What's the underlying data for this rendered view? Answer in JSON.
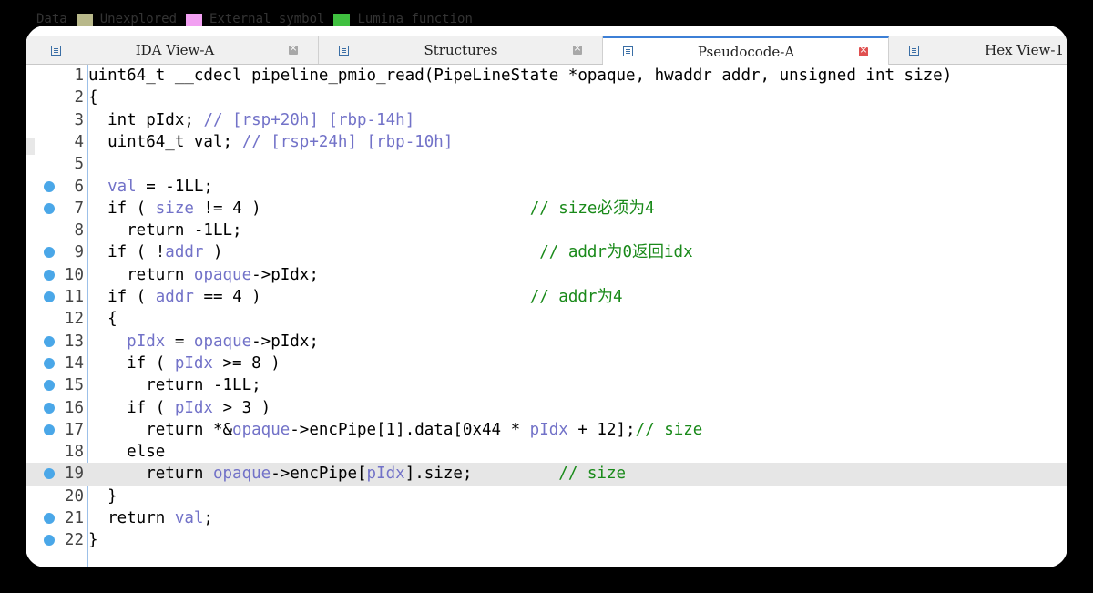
{
  "legend": [
    {
      "label": "Data",
      "color": ""
    },
    {
      "label": "Unexplored",
      "color": "#b8b88a"
    },
    {
      "label": "External symbol",
      "color": "#f2a0f2"
    },
    {
      "label": "Lumina function",
      "color": "#40c040"
    }
  ],
  "tabs": [
    {
      "label": "IDA View-A",
      "active": false
    },
    {
      "label": "Structures",
      "active": false
    },
    {
      "label": "Pseudocode-A",
      "active": true
    },
    {
      "label": "Hex View-1",
      "active": false
    }
  ],
  "colors": {
    "variable": "#7272c8",
    "comment": "#1a8a1a",
    "breakpoint": "#4aa7e8",
    "highlight": "#e6e6e6",
    "active_tab_accent": "#3c7fd6"
  },
  "code": [
    {
      "n": "1",
      "bp": false,
      "hl": false,
      "segs": [
        {
          "t": "uint64_t __cdecl pipeline_pmio_read(PipeLineState *opaque, hwaddr addr, unsigned int size)"
        }
      ]
    },
    {
      "n": "2",
      "bp": false,
      "hl": false,
      "segs": [
        {
          "t": "{"
        }
      ]
    },
    {
      "n": "3",
      "bp": false,
      "hl": false,
      "segs": [
        {
          "t": "  int pIdx; "
        },
        {
          "t": "// [rsp+20h] [rbp-14h]",
          "c": "var"
        }
      ]
    },
    {
      "n": "4",
      "bp": false,
      "hl": false,
      "segs": [
        {
          "t": "  uint64_t val; "
        },
        {
          "t": "// [rsp+24h] [rbp-10h]",
          "c": "var"
        }
      ]
    },
    {
      "n": "5",
      "bp": false,
      "hl": false,
      "segs": [
        {
          "t": ""
        }
      ]
    },
    {
      "n": "6",
      "bp": true,
      "hl": false,
      "segs": [
        {
          "t": "  "
        },
        {
          "t": "val",
          "c": "var"
        },
        {
          "t": " = -1LL;"
        }
      ]
    },
    {
      "n": "7",
      "bp": true,
      "hl": false,
      "segs": [
        {
          "t": "  if ( "
        },
        {
          "t": "size",
          "c": "var"
        },
        {
          "t": " != 4 )                            "
        },
        {
          "t": "// size必须为4",
          "c": "cmt"
        }
      ]
    },
    {
      "n": "8",
      "bp": false,
      "hl": false,
      "segs": [
        {
          "t": "    return -1LL;"
        }
      ]
    },
    {
      "n": "9",
      "bp": true,
      "hl": false,
      "segs": [
        {
          "t": "  if ( !"
        },
        {
          "t": "addr",
          "c": "var"
        },
        {
          "t": " )                                 "
        },
        {
          "t": "// addr为0返回idx",
          "c": "cmt"
        }
      ]
    },
    {
      "n": "10",
      "bp": true,
      "hl": false,
      "segs": [
        {
          "t": "    return "
        },
        {
          "t": "opaque",
          "c": "var"
        },
        {
          "t": "->pIdx;"
        }
      ]
    },
    {
      "n": "11",
      "bp": true,
      "hl": false,
      "segs": [
        {
          "t": "  if ( "
        },
        {
          "t": "addr",
          "c": "var"
        },
        {
          "t": " == 4 )                            "
        },
        {
          "t": "// addr为4",
          "c": "cmt"
        }
      ]
    },
    {
      "n": "12",
      "bp": false,
      "hl": false,
      "segs": [
        {
          "t": "  {"
        }
      ]
    },
    {
      "n": "13",
      "bp": true,
      "hl": false,
      "segs": [
        {
          "t": "    "
        },
        {
          "t": "pIdx",
          "c": "var"
        },
        {
          "t": " = "
        },
        {
          "t": "opaque",
          "c": "var"
        },
        {
          "t": "->pIdx;"
        }
      ]
    },
    {
      "n": "14",
      "bp": true,
      "hl": false,
      "segs": [
        {
          "t": "    if ( "
        },
        {
          "t": "pIdx",
          "c": "var"
        },
        {
          "t": " >= 8 )"
        }
      ]
    },
    {
      "n": "15",
      "bp": true,
      "hl": false,
      "segs": [
        {
          "t": "      return -1LL;"
        }
      ]
    },
    {
      "n": "16",
      "bp": true,
      "hl": false,
      "segs": [
        {
          "t": "    if ( "
        },
        {
          "t": "pIdx",
          "c": "var"
        },
        {
          "t": " > 3 )"
        }
      ]
    },
    {
      "n": "17",
      "bp": true,
      "hl": false,
      "segs": [
        {
          "t": "      return *&"
        },
        {
          "t": "opaque",
          "c": "var"
        },
        {
          "t": "->encPipe[1].data[0x44 * "
        },
        {
          "t": "pIdx",
          "c": "var"
        },
        {
          "t": " + 12];"
        },
        {
          "t": "// size",
          "c": "cmt"
        }
      ]
    },
    {
      "n": "18",
      "bp": false,
      "hl": false,
      "segs": [
        {
          "t": "    else"
        }
      ]
    },
    {
      "n": "19",
      "bp": true,
      "hl": true,
      "segs": [
        {
          "t": "      return "
        },
        {
          "t": "opaque",
          "c": "var"
        },
        {
          "t": "->encPipe["
        },
        {
          "t": "pIdx",
          "c": "var"
        },
        {
          "t": "].size;         "
        },
        {
          "t": "// size",
          "c": "cmt"
        }
      ]
    },
    {
      "n": "20",
      "bp": false,
      "hl": false,
      "segs": [
        {
          "t": "  }"
        }
      ]
    },
    {
      "n": "21",
      "bp": true,
      "hl": false,
      "segs": [
        {
          "t": "  return "
        },
        {
          "t": "val",
          "c": "var"
        },
        {
          "t": ";"
        }
      ]
    },
    {
      "n": "22",
      "bp": true,
      "hl": false,
      "segs": [
        {
          "t": "}"
        }
      ]
    }
  ]
}
